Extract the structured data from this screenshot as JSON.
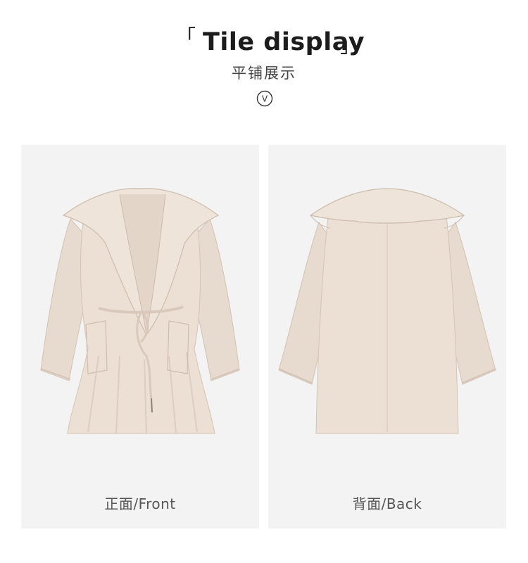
{
  "header": {
    "bracket_left": "「",
    "title": "Tile display",
    "bracket_right": "」",
    "subtitle": "平铺展示",
    "badge_letter": "V"
  },
  "panels": [
    {
      "caption": "正面/Front",
      "image": "coat-front-image"
    },
    {
      "caption": "背面/Back",
      "image": "coat-back-image"
    }
  ],
  "colors": {
    "panel_bg": "#f3f3f3",
    "coat": "#ece0d5",
    "coat_shadow": "#d9cbbd",
    "coat_line": "#c9b8a8"
  }
}
